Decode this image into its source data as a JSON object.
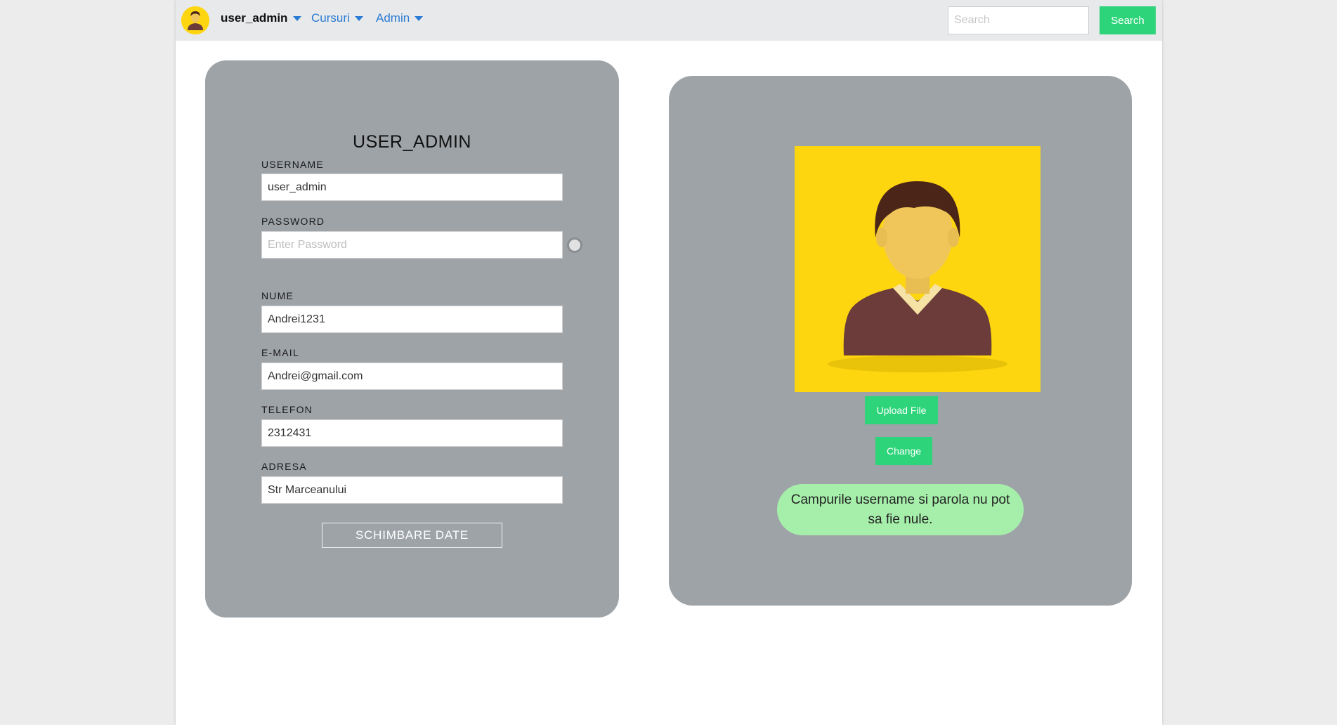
{
  "navbar": {
    "username": "user_admin",
    "menu_cursuri": "Cursuri",
    "menu_admin": "Admin",
    "search_placeholder": "Search",
    "search_button": "Search"
  },
  "profile": {
    "title": "USER_ADMIN",
    "fields": {
      "username": {
        "label": "USERNAME",
        "value": "user_admin"
      },
      "password": {
        "label": "PASSWORD",
        "placeholder": "Enter Password"
      },
      "nume": {
        "label": "NUME",
        "value": "Andrei1231"
      },
      "email": {
        "label": "E-MAIL",
        "value": "Andrei@gmail.com"
      },
      "telefon": {
        "label": "TELEFON",
        "value": "2312431"
      },
      "adresa": {
        "label": "ADRESA",
        "value": "Str Marceanului"
      }
    },
    "submit_label": "SCHIMBARE DATE"
  },
  "photo_panel": {
    "upload_label": "Upload File",
    "change_label": "Change",
    "message": "Campurile username si parola nu pot sa fie nule."
  },
  "colors": {
    "accent_green": "#2ed47a",
    "avatar_yellow": "#fdd60f",
    "card_gray": "#9ea3a8",
    "message_green": "#a6efab",
    "link_blue": "#2a7bd3"
  },
  "icons": [
    "user-avatar-icon",
    "caret-down-icon",
    "toggle-icon"
  ]
}
